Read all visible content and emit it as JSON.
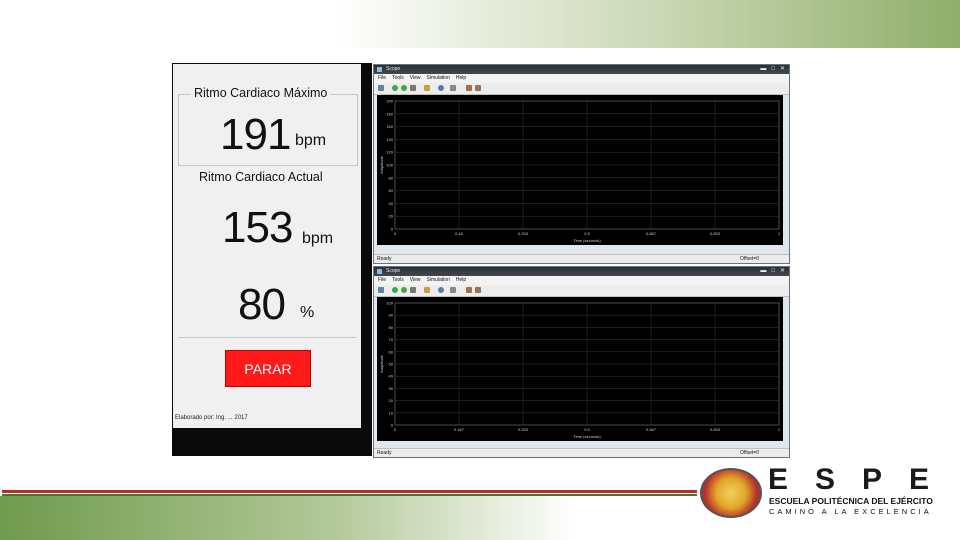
{
  "slide": {
    "band_colors": {
      "green": "#8fae6a",
      "red_stripe": "#c0282b",
      "green_stripe": "#3a7a2a"
    }
  },
  "monitor": {
    "max_title": "Ritmo Cardiaco Máximo",
    "max_value": "191",
    "max_unit": "bpm",
    "actual_title": "Ritmo Cardiaco Actual",
    "actual_value": "153",
    "actual_unit": "bpm",
    "percent_value": "80",
    "percent_unit": "%",
    "stop_label": "PARAR",
    "stop_color": "#ff1a1a",
    "credit": "Elaborado por: Ing. ... 2017"
  },
  "scope_top": {
    "title": "Scope",
    "menu": [
      "File",
      "Tools",
      "View",
      "Simulation",
      "Help"
    ],
    "status_left": "Ready",
    "status_right": "Offset=0",
    "y_ticks": [
      "200",
      "180",
      "160",
      "140",
      "120",
      "100",
      "80",
      "60",
      "40",
      "20",
      "0"
    ],
    "x_ticks": [
      "0",
      "0.16",
      "0.333",
      "0.5",
      "0.667",
      "0.833",
      "1"
    ],
    "y_label": "Amplitude",
    "x_label": "Time (seconds)"
  },
  "scope_bottom": {
    "title": "Scope",
    "menu": [
      "File",
      "Tools",
      "View",
      "Simulation",
      "Help"
    ],
    "status_left": "Ready",
    "status_right": "Offset=0",
    "y_ticks": [
      "100",
      "90",
      "80",
      "70",
      "60",
      "50",
      "40",
      "30",
      "20",
      "10",
      "0"
    ],
    "x_ticks": [
      "0",
      "0.167",
      "0.333",
      "0.5",
      "0.667",
      "0.833",
      "1"
    ],
    "y_label": "Amplitude",
    "x_label": "Time (seconds)"
  },
  "logo": {
    "letters": "ESPE",
    "name": "ESCUELA POLITÉCNICA DEL EJÉRCITO",
    "motto": "CAMINO A LA EXCELENCIA",
    "seal_text": "ESCUELA POLITÉCNICA DEL EJÉRCITO"
  },
  "window_controls": {
    "minimize": "▬",
    "maximize": "□",
    "close": "✕"
  }
}
